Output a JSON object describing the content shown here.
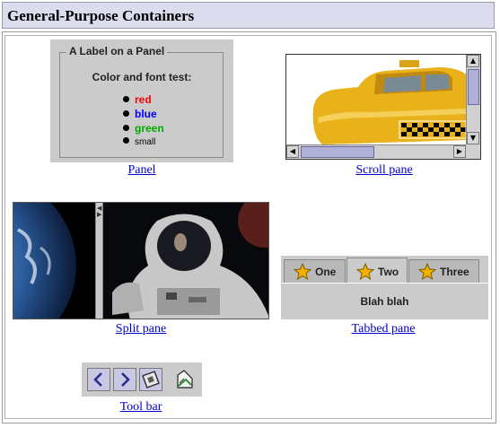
{
  "header": {
    "title": "General-Purpose Containers"
  },
  "panel": {
    "title": "A Label on a Panel",
    "subtitle": "Color and font test:",
    "items": [
      {
        "label": "red",
        "color": "#ff0000"
      },
      {
        "label": "blue",
        "color": "#0000ff"
      },
      {
        "label": "green",
        "color": "#00aa00"
      },
      {
        "label": "small",
        "color": "#000000"
      }
    ],
    "link": "Panel"
  },
  "scroll_pane": {
    "link": "Scroll pane",
    "image": "yellow-taxi-image"
  },
  "split_pane": {
    "link": "Split pane",
    "left_image": "earth-image",
    "right_image": "astronaut-image"
  },
  "tabbed_pane": {
    "tabs": [
      {
        "label": "One"
      },
      {
        "label": "Two"
      },
      {
        "label": "Three"
      }
    ],
    "selected": "Two",
    "content": "Blah blah",
    "link": "Tabbed pane"
  },
  "toolbar": {
    "buttons": [
      "back-arrow-icon",
      "forward-arrow-icon",
      "screen-icon",
      "document-icon"
    ],
    "link": "Tool bar"
  }
}
